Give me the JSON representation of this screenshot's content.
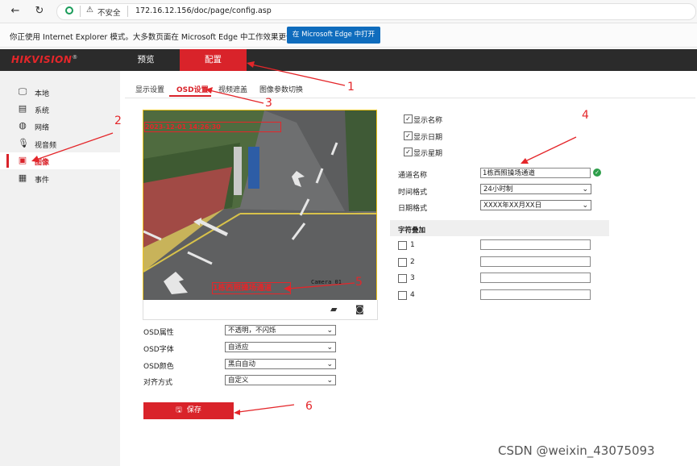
{
  "browser": {
    "security_label": "不安全",
    "url": "172.16.12.156/doc/page/config.asp",
    "ie_mode_message": "你正使用 Internet Explorer 模式。大多数页面在 Microsoft Edge 中工作效果更佳。",
    "open_in_edge_label": "在 Microsoft Edge 中打开"
  },
  "app": {
    "logo": "HIKVISION",
    "logo_mark": "®",
    "nav": [
      {
        "label": "预览"
      },
      {
        "label": "配置"
      }
    ]
  },
  "sidebar": {
    "items": [
      {
        "label": "本地",
        "icon": "monitor-icon"
      },
      {
        "label": "系统",
        "icon": "system-icon"
      },
      {
        "label": "网络",
        "icon": "globe-icon"
      },
      {
        "label": "视音频",
        "icon": "audio-video-icon"
      },
      {
        "label": "图像",
        "icon": "image-icon"
      },
      {
        "label": "事件",
        "icon": "calendar-icon"
      }
    ],
    "active": "图像"
  },
  "tabs": [
    {
      "label": "显示设置"
    },
    {
      "label": "OSD设置"
    },
    {
      "label": "视频遮盖"
    },
    {
      "label": "图像参数切换"
    }
  ],
  "video": {
    "osd_datetime": "2023-12-01 14:26:30",
    "osd_channel": "1栋西照操场通道",
    "camera_label": "Camera 01"
  },
  "osd_form": {
    "rows": [
      {
        "label": "OSD属性",
        "value": "不透明，不闪烁"
      },
      {
        "label": "OSD字体",
        "value": "自适应"
      },
      {
        "label": "OSD颜色",
        "value": "黑白自动"
      },
      {
        "label": "对齐方式",
        "value": "自定义"
      }
    ]
  },
  "display": {
    "checkboxes": [
      {
        "label": "显示名称",
        "checked": true
      },
      {
        "label": "显示日期",
        "checked": true
      },
      {
        "label": "显示星期",
        "checked": true
      }
    ],
    "channel_name_label": "通道名称",
    "channel_name_value": "1栋西照操场通道",
    "time_format_label": "时间格式",
    "time_format_value": "24小时制",
    "date_format_label": "日期格式",
    "date_format_value": "XXXX年XX月XX日"
  },
  "text_overlay": {
    "title": "字符叠加",
    "items": [
      {
        "num": "1",
        "value": ""
      },
      {
        "num": "2",
        "value": ""
      },
      {
        "num": "3",
        "value": ""
      },
      {
        "num": "4",
        "value": ""
      }
    ]
  },
  "save_label": "保存",
  "annotations": [
    "1",
    "2",
    "3",
    "4",
    "5",
    "6"
  ],
  "watermark": "CSDN @weixin_43075093",
  "colors": {
    "brand_red": "#d9232a",
    "annotation_red": "#e4262a",
    "edge_blue": "#0f6cbd",
    "topbar": "#2b2b2b"
  }
}
